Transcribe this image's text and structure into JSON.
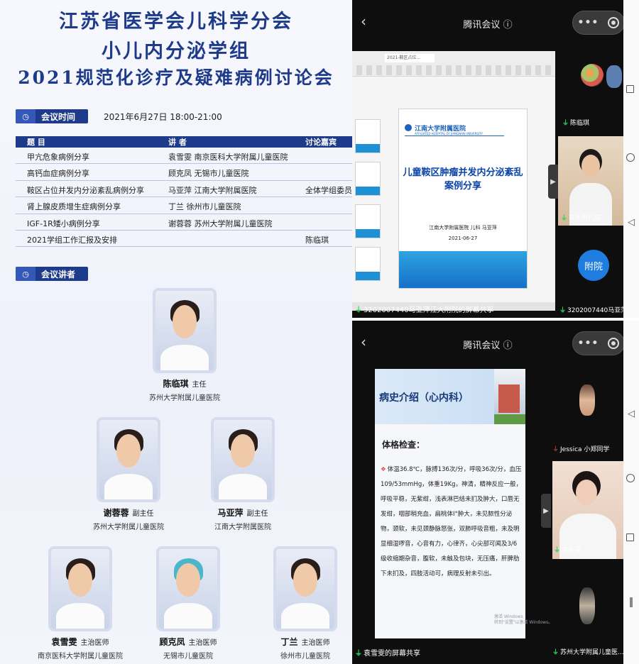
{
  "poster": {
    "title_line1": "江苏省医学会儿科学分会",
    "title_line2": "小儿内分泌学组",
    "title_line3": "2021规范化诊疗及疑难病例讨论会",
    "time_section_label": "会议时间",
    "meeting_time": "2021年6月27日 18:00-21:00",
    "schedule_headers": {
      "topic": "题  目",
      "speaker": "讲  者",
      "discussion": "讨论嘉宾"
    },
    "schedule": [
      {
        "topic": "甲亢危象病例分享",
        "speaker": "袁雪雯  南京医科大学附属儿童医院",
        "discussion": ""
      },
      {
        "topic": "高钙血症病例分享",
        "speaker": "顾克凤  无锡市儿童医院",
        "discussion": ""
      },
      {
        "topic": "鞍区占位并发内分泌紊乱病例分享",
        "speaker": "马亚萍  江南大学附属医院",
        "discussion": "全体学组委员"
      },
      {
        "topic": "肾上腺皮质增生症病例分享",
        "speaker": "丁兰  徐州市儿童医院",
        "discussion": ""
      },
      {
        "topic": "IGF-1R矮小病例分享",
        "speaker": "谢蓉蓉  苏州大学附属儿童医院",
        "discussion": ""
      },
      {
        "topic": "2021学组工作汇报及安排",
        "speaker": "",
        "discussion": "陈临琪"
      }
    ],
    "speakers_section_label": "会议讲者",
    "speakers": [
      {
        "name": "陈临琪",
        "role": "主任",
        "hospital": "苏州大学附属儿童医院"
      },
      {
        "name": "谢蓉蓉",
        "role": "副主任",
        "hospital": "苏州大学附属儿童医院"
      },
      {
        "name": "马亚萍",
        "role": "副主任",
        "hospital": "江南大学附属医院"
      },
      {
        "name": "袁雪雯",
        "role": "主治医师",
        "hospital": "南京医科大学附属儿童医院"
      },
      {
        "name": "顾克凤",
        "role": "主治医师",
        "hospital": "无锡市儿童医院"
      },
      {
        "name": "丁兰",
        "role": "主治医师",
        "hospital": "徐州市儿童医院"
      }
    ]
  },
  "meeting_top": {
    "title": "腾讯会议",
    "title_icon": "info-icon",
    "back_icon": "chevron-left-icon",
    "ppt_tab": "2021-鞍区占位...",
    "slide": {
      "logo_text": "江南大学附属医院",
      "logo_en": "AFFILIATED HOSPITAL OF JIANGNAN UNIVERSITY",
      "title": "儿童鞍区肿瘤并发内分泌紊乱案例分享",
      "subtitle": "江南大学附属医院  儿科  马亚萍",
      "date": "2021-06-27"
    },
    "share_label": "3202007440马亚萍江大附院的屏幕共享",
    "participants": [
      {
        "name": "陈临琪",
        "mic": "on"
      },
      {
        "name": "苏大附儿院",
        "mic": "on"
      },
      {
        "name": "附院",
        "avatar_text": "附院",
        "mic": "none"
      },
      {
        "name": "3202007440马亚萍...",
        "mic": "on"
      }
    ]
  },
  "meeting_bottom": {
    "title": "腾讯会议",
    "title_icon": "info-icon",
    "back_icon": "chevron-left-icon",
    "slide": {
      "header": "病史介绍（心内科）",
      "section": "体格检查：",
      "body": "体温36.8℃，脉搏136次/分，呼吸36次/分，血压 109/53mmHg，体重19Kg，神清，精神反应一般，呼吸平稳，无紫绀，浅表淋巴结未扪及肿大，口唇无发绀，咽部稍充血，扁桃体I°肿大，未见脓性分泌物，颈软，未见颈静脉怒张，双肺呼吸音粗，未及明显细湿啰音，心音有力，心律齐，心尖部可闻及3/6级收缩期杂音，腹软，未触及包块，无压痛，肝脾肋下未扪及，四肢活动可，病理反射未引出。",
      "watermark_line1": "激活 Windows",
      "watermark_line2": "转到\"设置\"以激活 Windows。"
    },
    "share_label": "袁雪雯的屏幕共享",
    "participants": [
      {
        "name": "Jessica 小郑同学",
        "mic": "off"
      },
      {
        "name": "袁雪雯",
        "mic": "on"
      },
      {
        "name": "苏州大学附属儿童医...",
        "mic": "on"
      }
    ]
  },
  "colors": {
    "poster_navy": "#1e3a8a",
    "meeting_bg": "#0e0e0e",
    "mic_green": "#2fd15a",
    "tencent_blue": "#1f7de0"
  }
}
